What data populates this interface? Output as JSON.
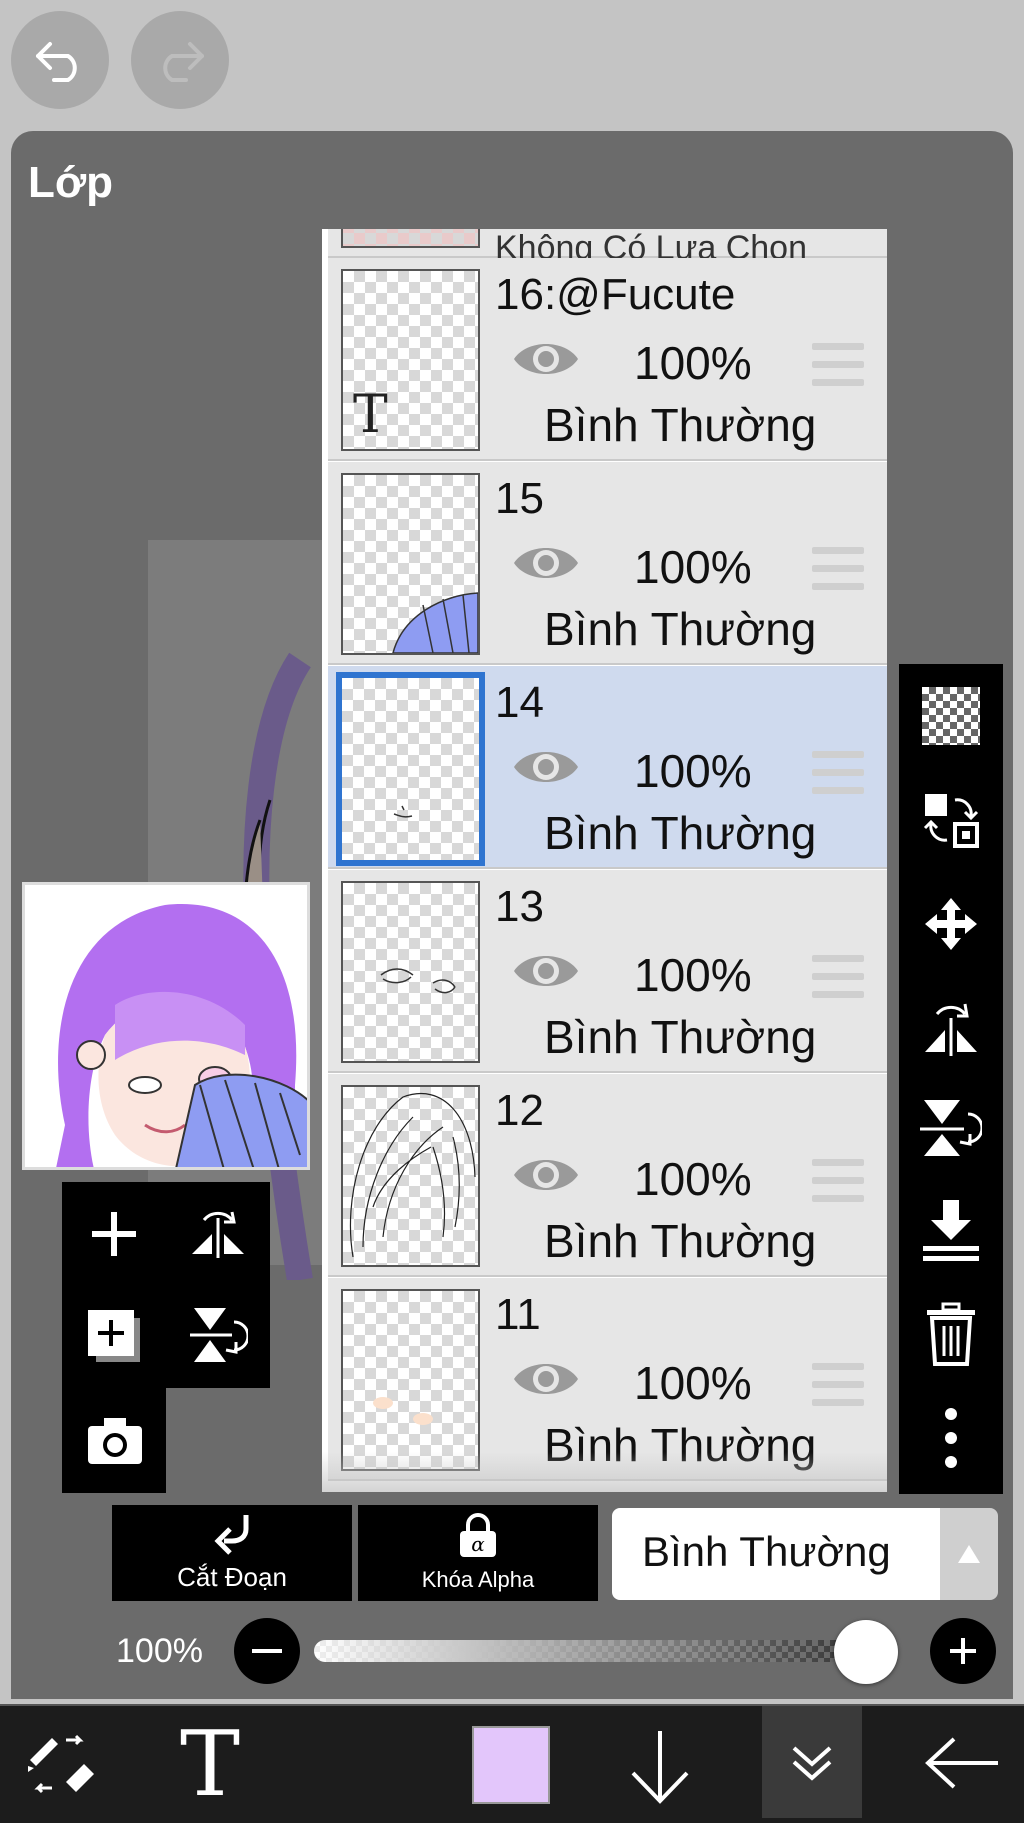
{
  "header": {
    "undo_icon": "undo-arrow-icon",
    "redo_icon": "redo-arrow-icon"
  },
  "panel": {
    "title": "Lớp"
  },
  "layers": [
    {
      "name": "16:@Fucute",
      "opacity": "100%",
      "mode": "Bình Thường",
      "thumb": "text-T",
      "selected": false
    },
    {
      "name": "15",
      "opacity": "100%",
      "mode": "Bình Thường",
      "thumb": "fan",
      "selected": false
    },
    {
      "name": "14",
      "opacity": "100%",
      "mode": "Bình Thường",
      "thumb": "small-stroke",
      "selected": true
    },
    {
      "name": "13",
      "opacity": "100%",
      "mode": "Bình Thường",
      "thumb": "eyes",
      "selected": false
    },
    {
      "name": "12",
      "opacity": "100%",
      "mode": "Bình Thường",
      "thumb": "hair-lines",
      "selected": false
    },
    {
      "name": "11",
      "opacity": "100%",
      "mode": "Bình Thường",
      "thumb": "blush",
      "selected": false
    }
  ],
  "partial_top_layer": {
    "name": "Không Có Lựa Chọn"
  },
  "right_toolbar": [
    "transparency-icon",
    "swap-layer-icon",
    "move-icon",
    "flip-horizontal-icon",
    "flip-vertical-icon",
    "merge-down-icon",
    "trash-icon",
    "more-icon"
  ],
  "left_toolbar": [
    "add-layer-icon",
    "flip-h-icon",
    "add-layer-copy-icon",
    "flip-v-icon",
    "camera-icon"
  ],
  "bottom_controls": {
    "clip_label": "Cắt Đoạn",
    "alpha_lock_label": "Khóa Alpha",
    "blend_mode": "Bình Thường",
    "opacity_value": "100%",
    "opacity_fraction": 1.0
  },
  "bottom_bar": {
    "tools": [
      "brush-eraser-icon",
      "text-tool-icon",
      "color-swatch",
      "arrow-down-icon",
      "collapse-icon",
      "back-arrow-icon"
    ],
    "text_tool_glyph": "T",
    "current_color": "#e3c6fb"
  },
  "colors": {
    "selected_layer_bg": "#cfdaee",
    "selected_border": "#2f74d0"
  }
}
